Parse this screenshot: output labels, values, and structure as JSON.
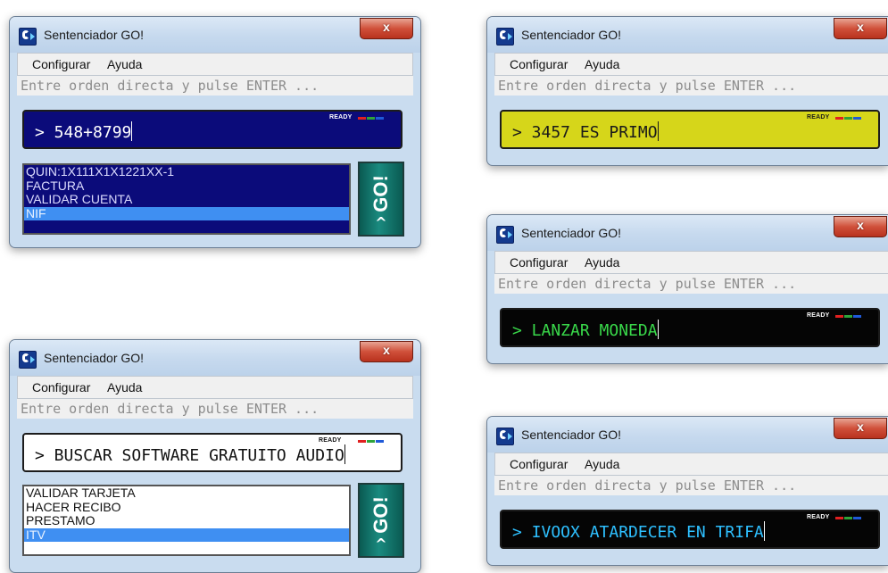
{
  "windows": [
    {
      "id": "w1",
      "title": "Sentenciador GO!",
      "close_label": "x",
      "menu": [
        "Configurar",
        "Ayuda"
      ],
      "prompt": "Entre orden directa y pulse ENTER ...",
      "command": "> 548+8799",
      "status": "READY",
      "display_bg": "#0b0b7a",
      "display_fg": "#ffffff",
      "list": [
        "QUIN:1X111X1X1221XX-1",
        "FACTURA",
        "VALIDAR CUENTA",
        "NIF"
      ],
      "selected": "NIF",
      "go_label": "GO!",
      "go_arrow": "^"
    },
    {
      "id": "w2",
      "title": "Sentenciador GO!",
      "close_label": "x",
      "menu": [
        "Configurar",
        "Ayuda"
      ],
      "prompt": "Entre orden directa y pulse ENTER ...",
      "command": "> 3457 ES PRIMO",
      "status": "READY",
      "display_bg": "#d6d61a",
      "display_fg": "#1a1a1a"
    },
    {
      "id": "w3",
      "title": "Sentenciador GO!",
      "close_label": "x",
      "menu": [
        "Configurar",
        "Ayuda"
      ],
      "prompt": "Entre orden directa y pulse ENTER ...",
      "command": "> LANZAR MONEDA",
      "status": "READY",
      "display_bg": "#050505",
      "display_fg": "#39d84a"
    },
    {
      "id": "w4",
      "title": "Sentenciador GO!",
      "close_label": "x",
      "menu": [
        "Configurar",
        "Ayuda"
      ],
      "prompt": "Entre orden directa y pulse ENTER ...",
      "command": "> BUSCAR SOFTWARE GRATUITO AUDIO",
      "status": "READY",
      "display_bg": "#ffffff",
      "display_fg": "#111111",
      "list": [
        "VALIDAR TARJETA",
        "HACER RECIBO",
        "PRESTAMO",
        "ITV"
      ],
      "selected": "ITV",
      "go_label": "GO!",
      "go_arrow": "^"
    },
    {
      "id": "w5",
      "title": "Sentenciador GO!",
      "close_label": "x",
      "menu": [
        "Configurar",
        "Ayuda"
      ],
      "prompt": "Entre orden directa y pulse ENTER ...",
      "command": "> IVOOX ATARDECER EN TRIFA",
      "status": "READY",
      "display_bg": "#050505",
      "display_fg": "#2ec0ff"
    }
  ]
}
